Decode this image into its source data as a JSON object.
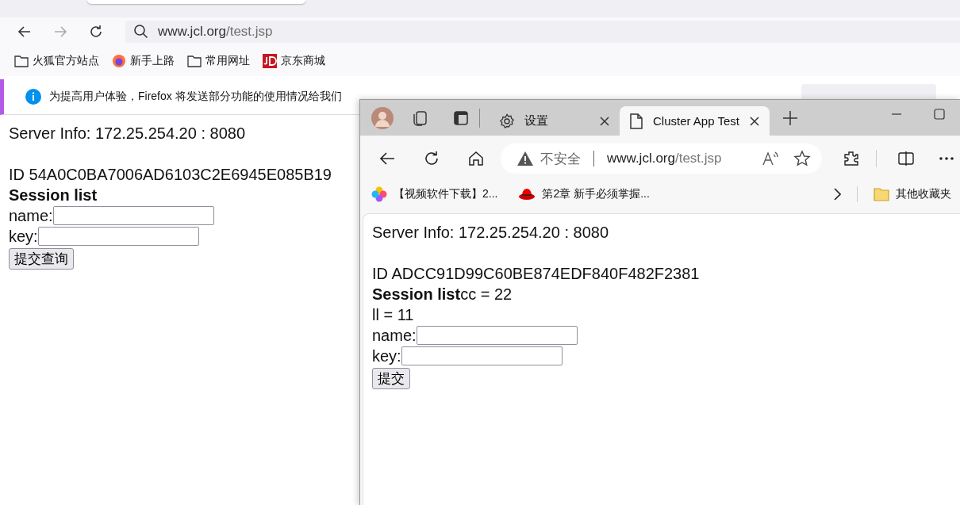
{
  "firefox": {
    "address": {
      "host": "www.jcl.org",
      "path": "/test.jsp"
    },
    "bookmarks": [
      {
        "label": "火狐官方站点",
        "kind": "folder"
      },
      {
        "label": "新手上路",
        "kind": "firefox"
      },
      {
        "label": "常用网址",
        "kind": "folder"
      },
      {
        "label": "京东商城",
        "kind": "jd"
      }
    ],
    "notice": {
      "text": "为提高用户体验，Firefox 将发送部分功能的使用情况给我们"
    },
    "page": {
      "server_info": "Server Info: 172.25.254.20 : 8080",
      "session_id": "ID 54A0C0BA7006AD6103C2E6945E085B19",
      "session_heading": "Session list",
      "fields": [
        {
          "label": "name:"
        },
        {
          "label": "key:"
        }
      ],
      "submit": "提交查询"
    }
  },
  "edge": {
    "tabs": [
      {
        "label": "设置",
        "kind": "settings",
        "selected": false
      },
      {
        "label": "Cluster App Test",
        "kind": "page",
        "selected": true
      }
    ],
    "address": {
      "security": "不安全",
      "host": "www.jcl.org",
      "path": "/test.jsp"
    },
    "bookmarks": [
      {
        "label": "【视频软件下载】2...",
        "kind": "flower"
      },
      {
        "label": "第2章 新手必须掌握...",
        "kind": "redhat"
      }
    ],
    "other_bookmarks": "其他收藏夹",
    "page": {
      "server_info": "Server Info: 172.25.254.20 : 8080",
      "session_id": "ID ADCC91D99C60BE874EDF840F482F2381",
      "session_heading": "Session list",
      "session_entries": [
        "cc = 22",
        "ll = 11"
      ],
      "fields": [
        {
          "label": "name:"
        },
        {
          "label": "key:"
        }
      ],
      "submit": "提交"
    }
  }
}
